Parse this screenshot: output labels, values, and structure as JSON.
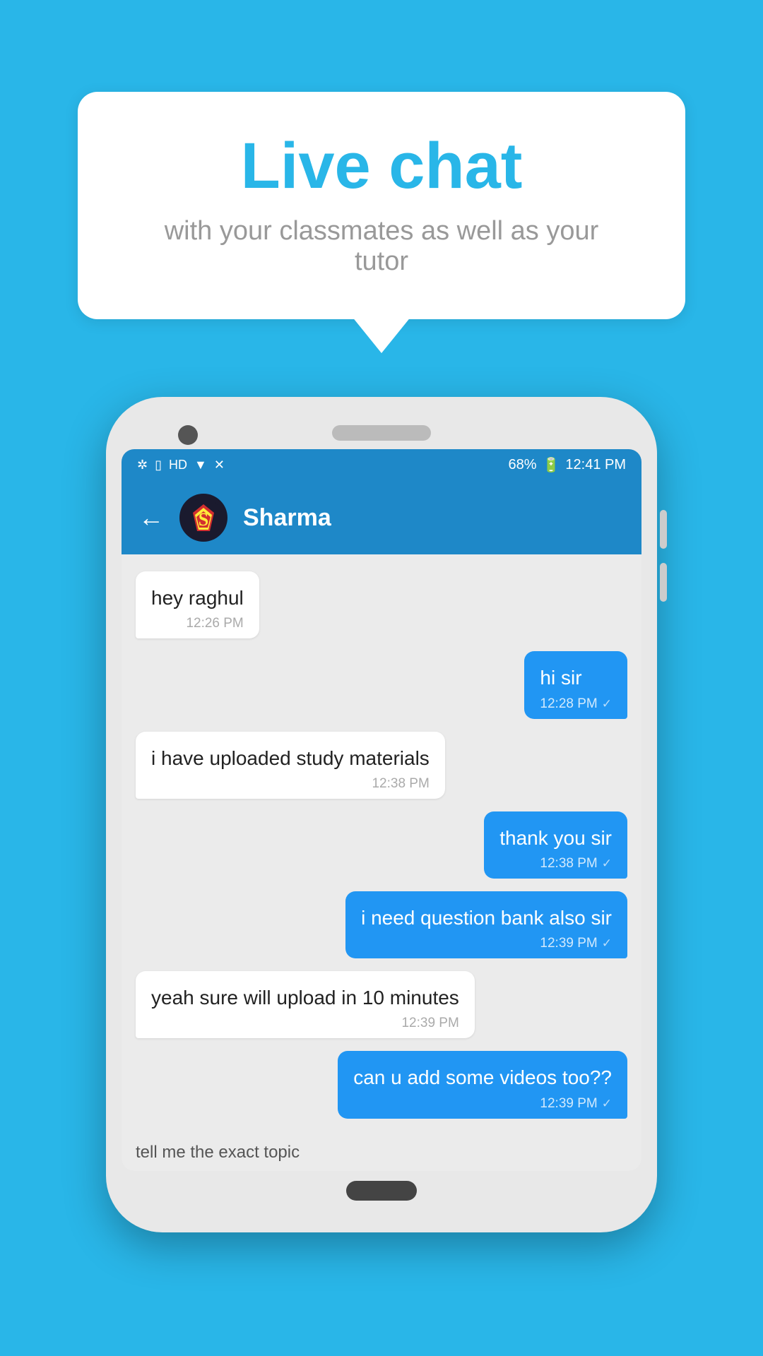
{
  "background_color": "#29b6e8",
  "bubble": {
    "title": "Live chat",
    "subtitle": "with your classmates as well as your tutor"
  },
  "phone": {
    "status_bar": {
      "left_icons": "* ⬡ HD ▲▼ ▼ ✕ ✕",
      "battery": "68%",
      "time": "12:41 PM"
    },
    "header": {
      "back_label": "←",
      "contact_name": "Sharma",
      "avatar_emoji": "🦸"
    },
    "messages": [
      {
        "id": "msg1",
        "type": "received",
        "text": "hey raghul",
        "time": "12:26 PM",
        "check": false
      },
      {
        "id": "msg2",
        "type": "sent",
        "text": "hi sir",
        "time": "12:28 PM",
        "check": true
      },
      {
        "id": "msg3",
        "type": "received",
        "text": "i have uploaded study materials",
        "time": "12:38 PM",
        "check": false
      },
      {
        "id": "msg4",
        "type": "sent",
        "text": "thank you sir",
        "time": "12:38 PM",
        "check": true
      },
      {
        "id": "msg5",
        "type": "sent",
        "text": "i need question bank also sir",
        "time": "12:39 PM",
        "check": true
      },
      {
        "id": "msg6",
        "type": "received",
        "text": "yeah sure will upload in 10 minutes",
        "time": "12:39 PM",
        "check": false
      },
      {
        "id": "msg7",
        "type": "sent",
        "text": "can u add some videos too??",
        "time": "12:39 PM",
        "check": true
      },
      {
        "id": "msg8",
        "type": "received",
        "text": "tell me the exact topic",
        "time": "",
        "check": false,
        "partial": true
      }
    ]
  }
}
